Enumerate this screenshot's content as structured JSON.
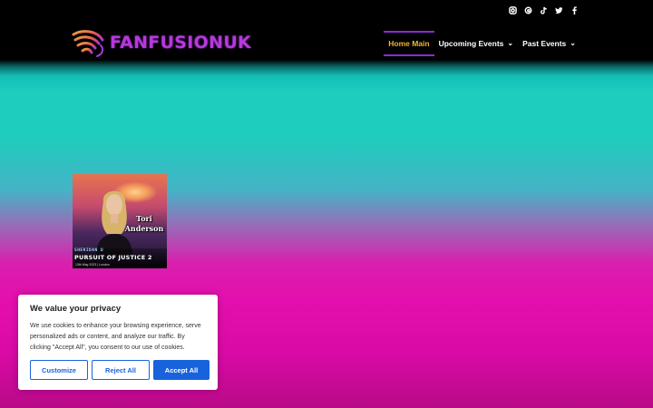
{
  "header": {
    "logo_text": "FANFUSIONUK",
    "social_icons": [
      "instagram-icon",
      "threads-icon",
      "tiktok-icon",
      "twitter-icon",
      "facebook-icon"
    ],
    "nav": [
      {
        "label": "Home Main",
        "active": true,
        "has_dropdown": false
      },
      {
        "label": "Upcoming Events",
        "active": false,
        "has_dropdown": true
      },
      {
        "label": "Past Events",
        "active": false,
        "has_dropdown": true
      }
    ]
  },
  "guest_card": {
    "name_line1": "Tori",
    "name_line2": "Anderson",
    "event_small": "SHERIDAN U",
    "event_title": "PURSUIT OF JUSTICE 2",
    "event_meta": "13th May 2023 | London"
  },
  "cookie_banner": {
    "title": "We value your privacy",
    "body": "We use cookies to enhance your browsing experience, serve personalized ads or content, and analyze our traffic. By clicking \"Accept All\", you consent to our use of cookies.",
    "customize_label": "Customize",
    "reject_label": "Reject All",
    "accept_label": "Accept All"
  },
  "colors": {
    "accent_nav": "#f5b52a",
    "brand_purple": "#b43ad9",
    "cookie_blue": "#1863dc",
    "teal": "#1ecdbd",
    "magenta": "#e40fae"
  }
}
